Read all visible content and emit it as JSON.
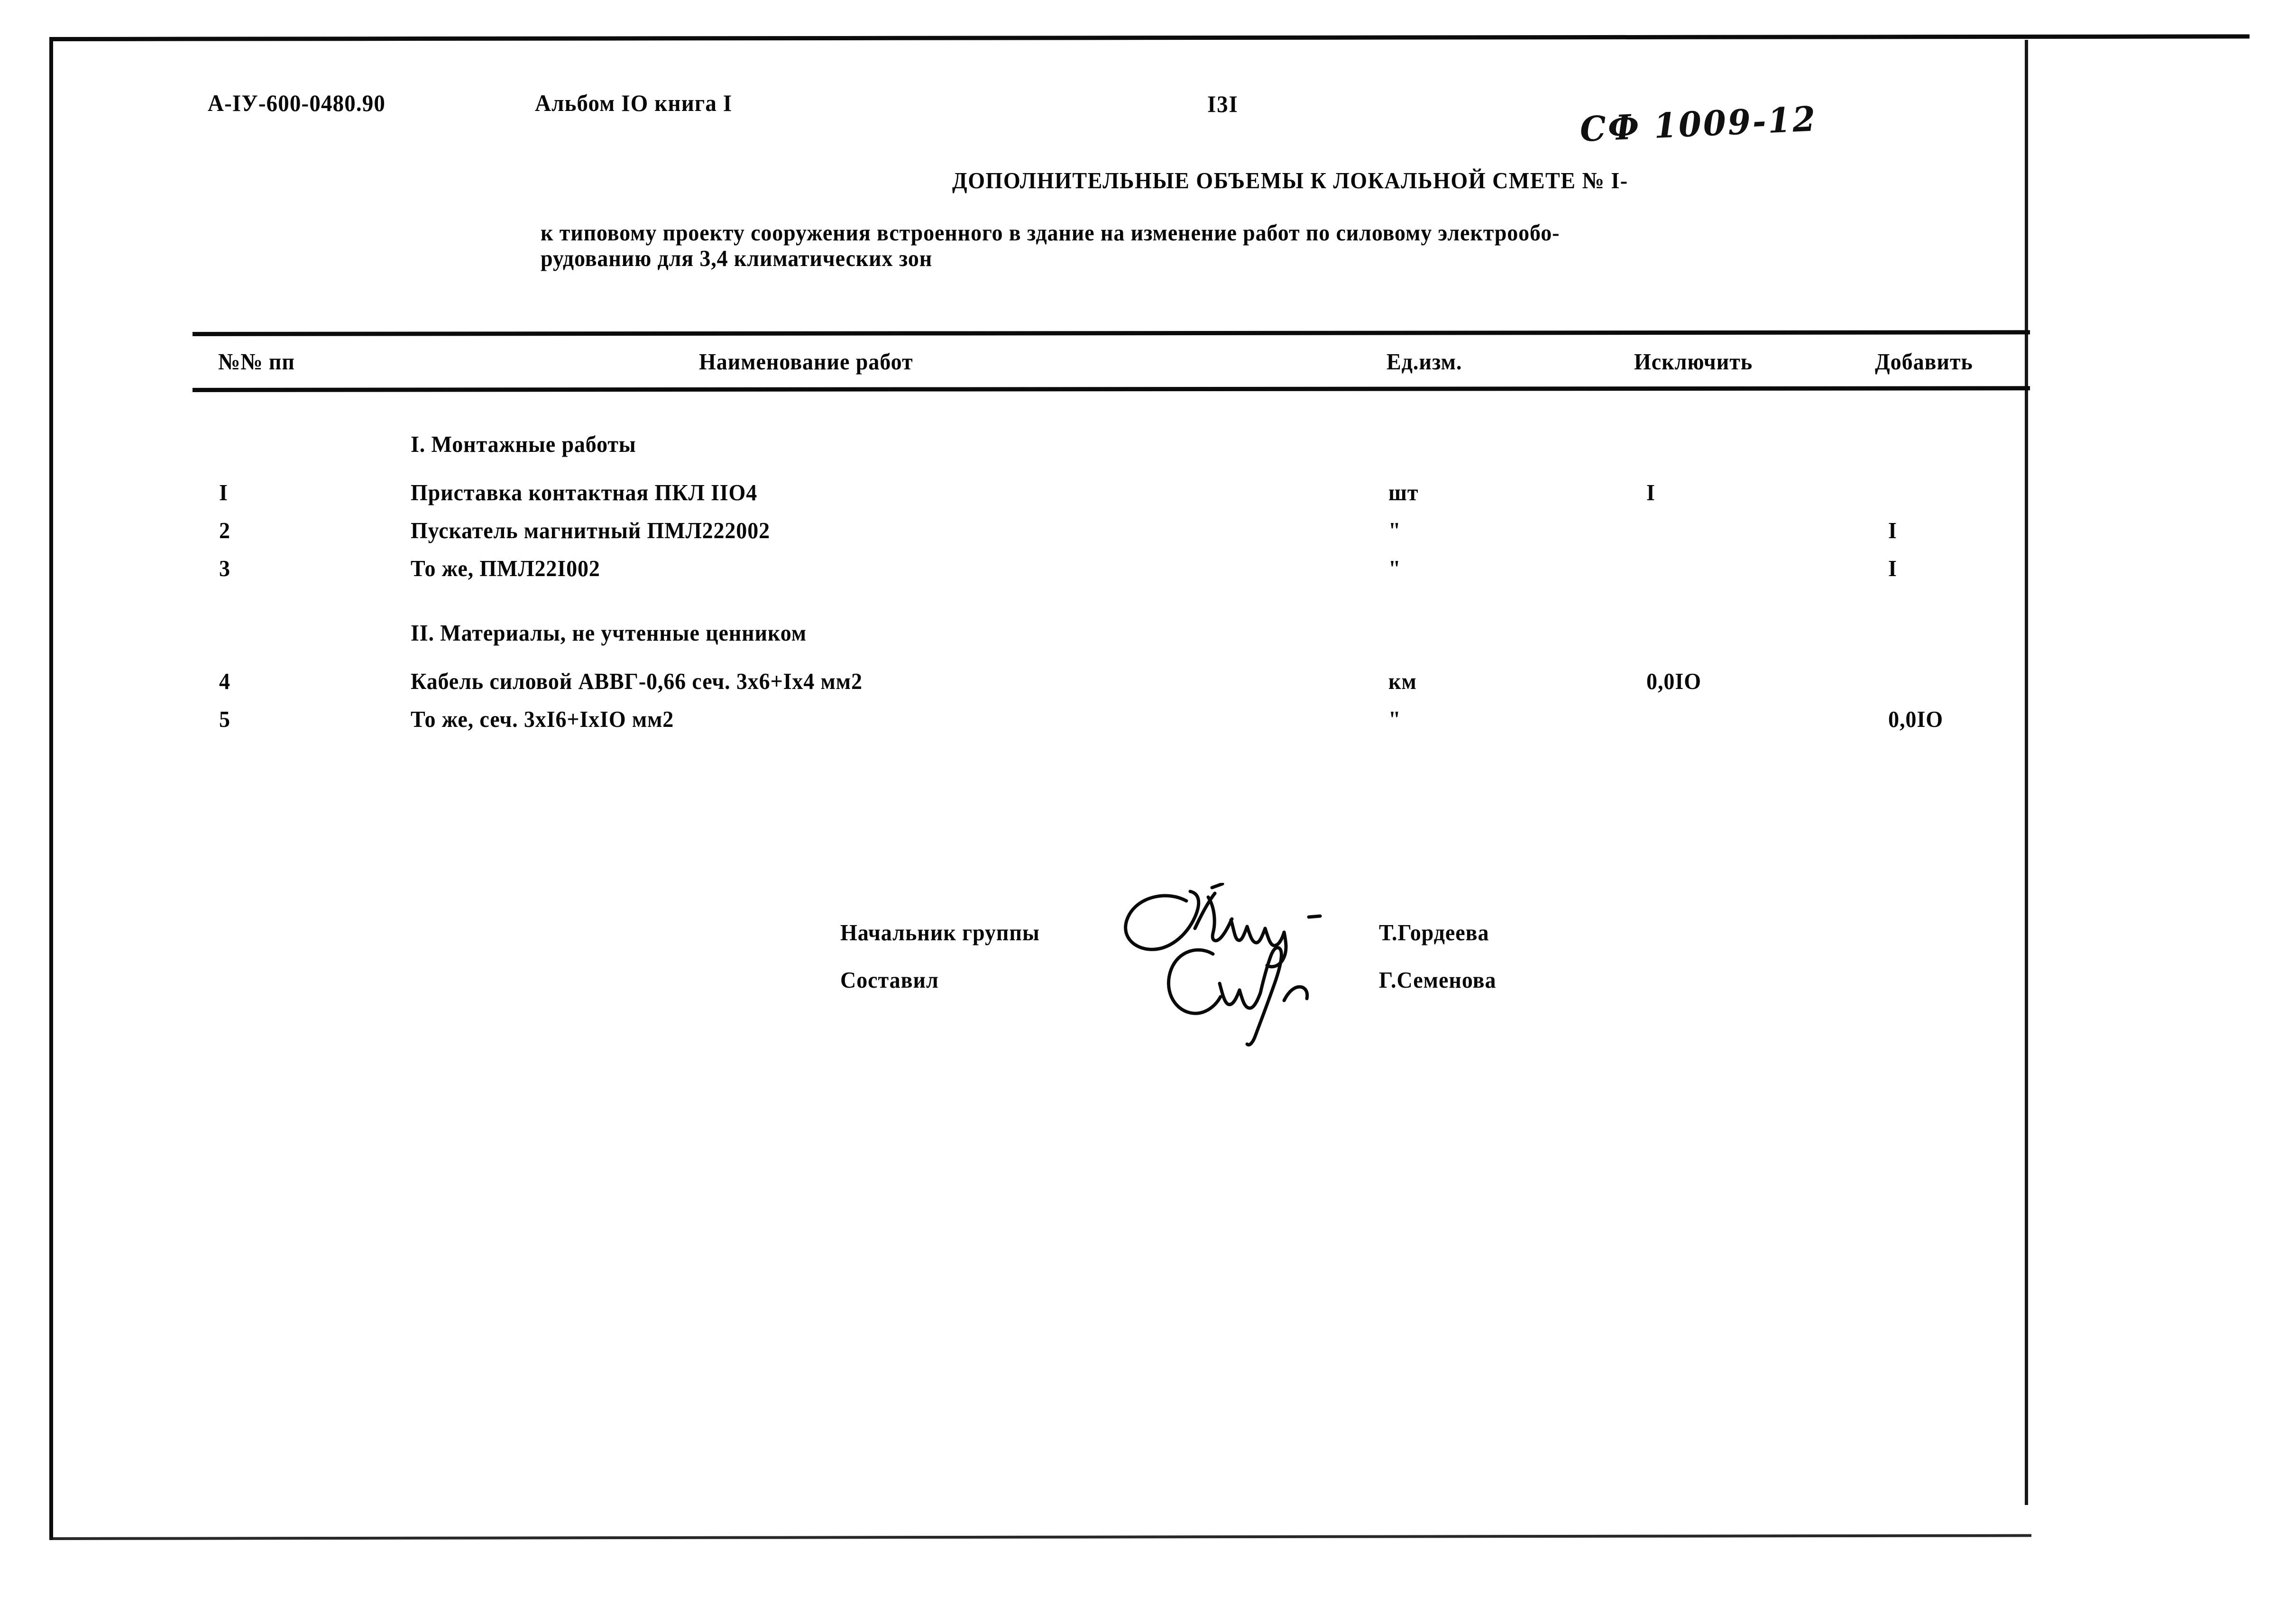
{
  "document": {
    "code": "А-IУ-600-0480.90",
    "album": "Альбом IO книга I",
    "page_number": "I3I",
    "handwritten_annotation": "СФ 1009-12"
  },
  "title": {
    "main": "ДОПОЛНИТЕЛЬНЫЕ ОБЪЕМЫ К ЛОКАЛЬНОЙ СМЕТЕ № I-",
    "subtitle_line_1": "к типовому проекту сооружения встроенного в здание на изменение работ по силовому электрообо-",
    "subtitle_line_2": "рудованию для 3,4 климатических зон"
  },
  "table": {
    "headers": {
      "number": "№№ пп",
      "name": "Наименование работ",
      "unit": "Ед.изм.",
      "exclude": "Исключить",
      "add": "Добавить"
    },
    "section_1_title": "I. Монтажные работы",
    "section_2_title": "II. Материалы, не учтенные ценником",
    "rows_section_1": [
      {
        "number": "I",
        "name": "Приставка контактная ПКЛ IIO4",
        "unit": "шт",
        "exclude": "I",
        "add": ""
      },
      {
        "number": "2",
        "name": "Пускатель магнитный ПМЛ222002",
        "unit": "\"",
        "exclude": "",
        "add": "I"
      },
      {
        "number": "3",
        "name": "То же, ПМЛ22I002",
        "unit": "\"",
        "exclude": "",
        "add": "I"
      }
    ],
    "rows_section_2": [
      {
        "number": "4",
        "name": "Кабель силовой АВВГ-0,66 сеч. 3x6+Ix4 мм2",
        "unit": "км",
        "exclude": "0,0IO",
        "add": ""
      },
      {
        "number": "5",
        "name": "То же, сеч. 3xI6+IxIO мм2",
        "unit": "\"",
        "exclude": "",
        "add": "0,0IO"
      }
    ]
  },
  "signatures": [
    {
      "role": "Начальник группы",
      "name": "Т.Гордеева"
    },
    {
      "role": "Составил",
      "name": "Г.Семенова"
    }
  ],
  "colors": {
    "ink": "#080808",
    "paper": "#ffffff"
  }
}
